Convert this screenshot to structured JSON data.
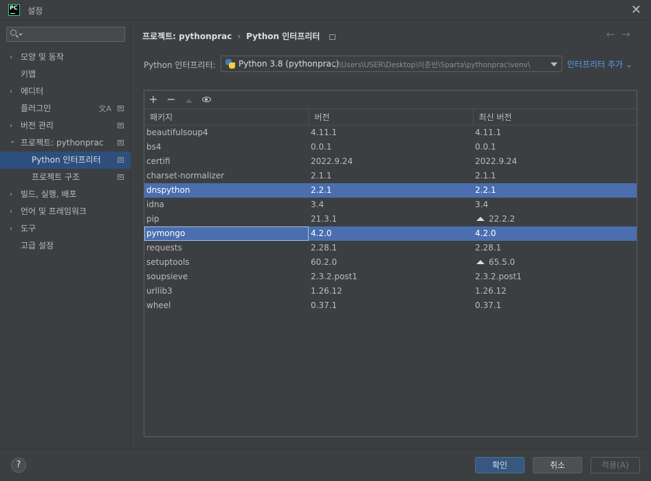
{
  "window": {
    "title": "설정",
    "app_icon_text": "PC"
  },
  "sidebar": {
    "search_placeholder": "",
    "items": [
      {
        "label": "모양 및 동작",
        "arrow": "›"
      },
      {
        "label": "키맵"
      },
      {
        "label": "에디터",
        "arrow": "›"
      },
      {
        "label": "플러그인",
        "lang_icon": "文A"
      },
      {
        "label": "버전 관리",
        "arrow": "›"
      },
      {
        "label": "프로젝트: pythonprac",
        "arrow": "⌄"
      },
      {
        "label": "Python 인터프리터"
      },
      {
        "label": "프로젝트 구조"
      },
      {
        "label": "빌드, 실행, 배포",
        "arrow": "›"
      },
      {
        "label": "언어 및 프레임워크",
        "arrow": "›"
      },
      {
        "label": "도구",
        "arrow": "›"
      },
      {
        "label": "고급 설정"
      }
    ]
  },
  "breadcrumb": {
    "project": "프로젝트: pythonprac",
    "separator": "›",
    "page": "Python 인터프리터"
  },
  "nav_arrows": {
    "back": "←",
    "forward": "→"
  },
  "interpreter": {
    "label": "Python 인터프리터:",
    "name": "Python 3.8 (pythonprac)",
    "path": "C:\\Users\\USER\\Desktop\\이준빈\\Sparta\\pythonprac\\venv\\",
    "add_label": "인터프리터 추가 ⌄"
  },
  "toolbar": {
    "add": "+",
    "remove": "−"
  },
  "table": {
    "columns": [
      "패키지",
      "버전",
      "최신 버전"
    ],
    "rows": [
      {
        "package": "beautifulsoup4",
        "version": "4.11.1",
        "latest": "4.11.1"
      },
      {
        "package": "bs4",
        "version": "0.0.1",
        "latest": "0.0.1"
      },
      {
        "package": "certifi",
        "version": "2022.9.24",
        "latest": "2022.9.24"
      },
      {
        "package": "charset-normalizer",
        "version": "2.1.1",
        "latest": "2.1.1"
      },
      {
        "package": "dnspython",
        "version": "2.2.1",
        "latest": "2.2.1"
      },
      {
        "package": "idna",
        "version": "3.4",
        "latest": "3.4"
      },
      {
        "package": "pip",
        "version": "21.3.1",
        "latest": "22.2.2"
      },
      {
        "package": "pymongo",
        "version": "4.2.0",
        "latest": "4.2.0"
      },
      {
        "package": "requests",
        "version": "2.28.1",
        "latest": "2.28.1"
      },
      {
        "package": "setuptools",
        "version": "60.2.0",
        "latest": "65.5.0"
      },
      {
        "package": "soupsieve",
        "version": "2.3.2.post1",
        "latest": "2.3.2.post1"
      },
      {
        "package": "urllib3",
        "version": "1.26.12",
        "latest": "1.26.12"
      },
      {
        "package": "wheel",
        "version": "0.37.1",
        "latest": "0.37.1"
      }
    ]
  },
  "footer": {
    "help": "?",
    "ok": "확인",
    "cancel": "취소",
    "apply": "적용(A)"
  },
  "colors": {
    "background": "#3c3f41",
    "selection": "#4b6eaf",
    "link": "#589df6",
    "primary_button": "#365880"
  }
}
